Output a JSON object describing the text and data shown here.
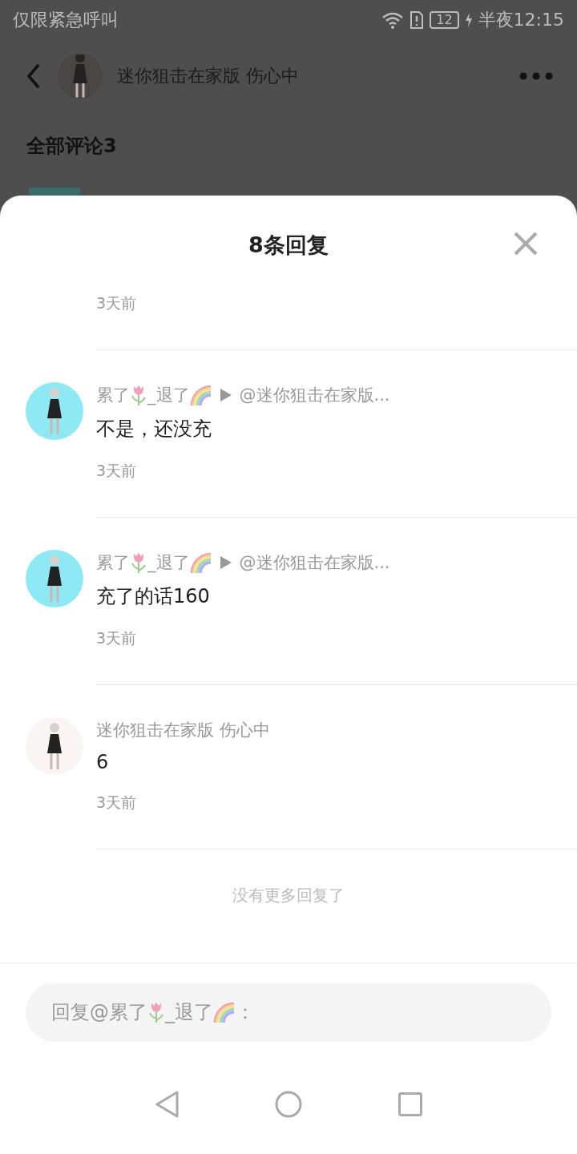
{
  "status_bar": {
    "carrier": "仅限紧急呼叫",
    "battery": "12",
    "time": "半夜12:15"
  },
  "header": {
    "title": "迷你狙击在家版 伤心中"
  },
  "comments_heading": "全部评论3",
  "sheet": {
    "title": "8条回复",
    "top_time": "3天前",
    "replies": [
      {
        "color": "#8ee9f5",
        "author": [
          {
            "kind": "text",
            "text": "累了"
          },
          {
            "kind": "tulip"
          },
          {
            "kind": "text",
            "text": "_退了"
          },
          {
            "kind": "rainbow"
          }
        ],
        "target": "@迷你狙击在家版...",
        "content": "不是，还没充",
        "time": "3天前"
      },
      {
        "color": "#8ee9f5",
        "author": [
          {
            "kind": "text",
            "text": "累了"
          },
          {
            "kind": "tulip"
          },
          {
            "kind": "text",
            "text": "_退了"
          },
          {
            "kind": "rainbow"
          }
        ],
        "target": "@迷你狙击在家版...",
        "content": "充了的话160",
        "time": "3天前"
      },
      {
        "color": "#fbf4f5",
        "author": [
          {
            "kind": "text",
            "text": "迷你狙击在家版 伤心中"
          }
        ],
        "content": "6",
        "time": "3天前"
      }
    ],
    "end_note": "没有更多回复了",
    "reply_field": {
      "placeholder": [
        {
          "kind": "text",
          "text": "回复@累了"
        },
        {
          "kind": "tulip"
        },
        {
          "kind": "text",
          "text": "_退了"
        },
        {
          "kind": "rainbow"
        },
        {
          "kind": "text",
          "text": "："
        }
      ]
    }
  }
}
